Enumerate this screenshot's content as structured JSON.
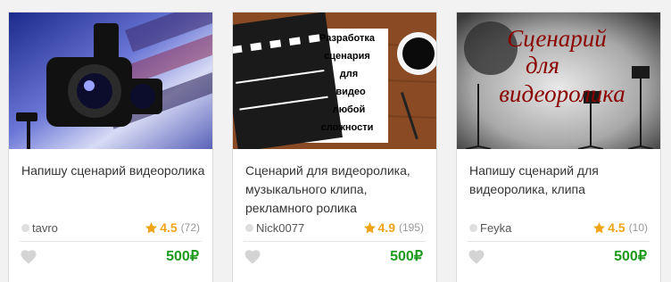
{
  "cards": [
    {
      "image": "camera-image",
      "title": "Напишу сценарий видеоролика",
      "seller": "tavro",
      "rating": "4.5",
      "rating_count": "(72)",
      "price": "500₽"
    },
    {
      "image": "clapperboard-image",
      "image_caption": [
        "Разработка",
        "сценария",
        "для",
        "видео",
        "любой",
        "сложности"
      ],
      "title": "Сценарий для видеоролика, музыкального клипа, рекламного ролика",
      "seller": "Nick0077",
      "rating": "4.9",
      "rating_count": "(195)",
      "price": "500₽"
    },
    {
      "image": "studio-image",
      "image_caption": [
        "Сценарий",
        "для",
        "видеоролика"
      ],
      "title": "Напишу сценарий для видеоролика, клипа",
      "seller": "Feyka",
      "rating": "4.5",
      "rating_count": "(10)",
      "price": "500₽"
    }
  ],
  "colors": {
    "rating": "#f1a417",
    "price": "#1e9a1e",
    "background": "#f2f2f2"
  },
  "icons": [
    "star-icon",
    "heart-icon",
    "online-status-icon"
  ]
}
